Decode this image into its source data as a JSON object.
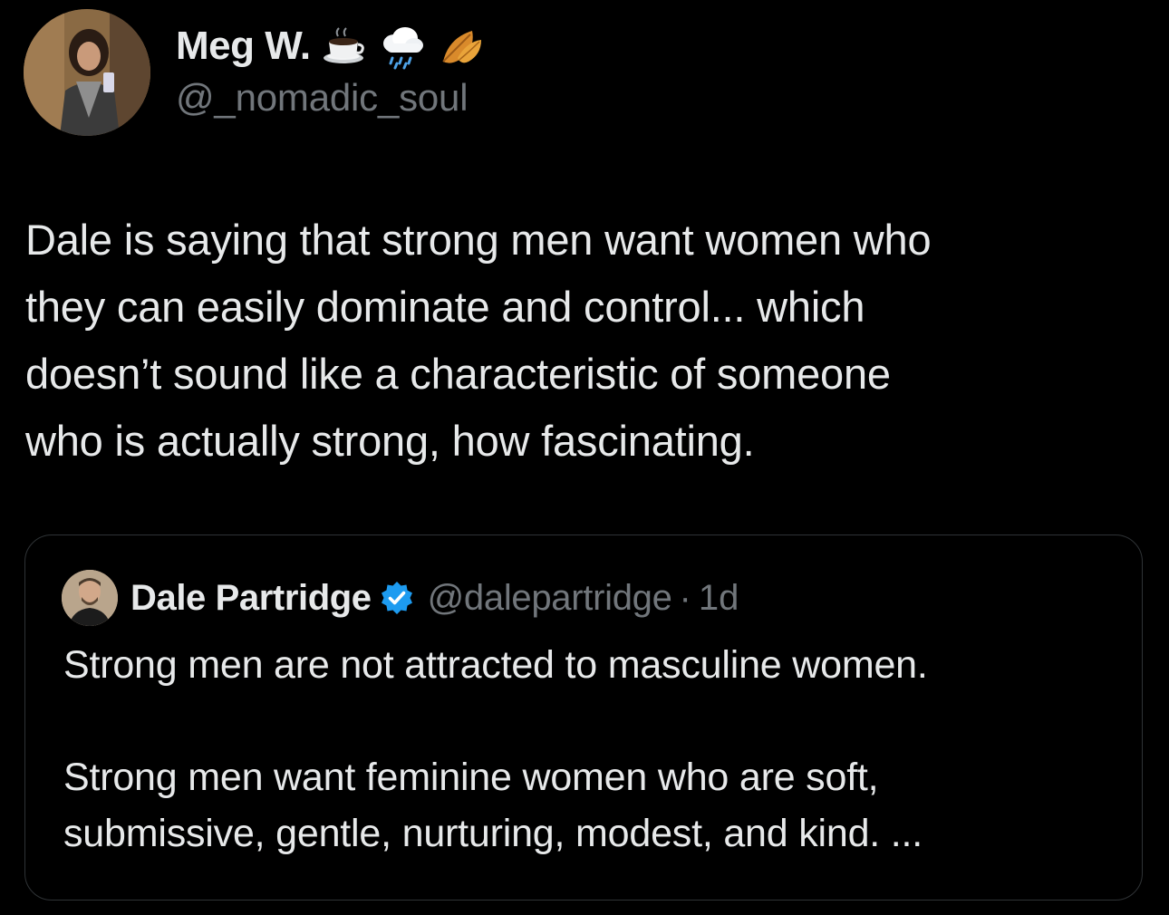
{
  "author": {
    "display_name": "Meg W.",
    "handle": "@_nomadic_soul",
    "name_emojis": [
      "coffee-icon",
      "cloud-rain-icon",
      "fallen-leaf-icon"
    ],
    "avatar": "user-avatar"
  },
  "tweet": {
    "text": "Dale is saying that strong men want women who\nthey can easily dominate and control... which\ndoesn’t sound like a characteristic of someone\nwho is actually strong, how fascinating."
  },
  "quoted_tweet": {
    "display_name": "Dale Partridge",
    "verified": true,
    "handle": "@dalepartridge",
    "separator": "·",
    "time": "1d",
    "text": "Strong men are not attracted to masculine women.\n\nStrong men want feminine women who are soft,\nsubmissive, gentle, nurturing, modest, and kind. ..."
  },
  "colors": {
    "background": "#000000",
    "primary_text": "#e7e9ea",
    "secondary_text": "#71767b",
    "border": "#2f3336",
    "verified_blue": "#1d9bf0"
  }
}
